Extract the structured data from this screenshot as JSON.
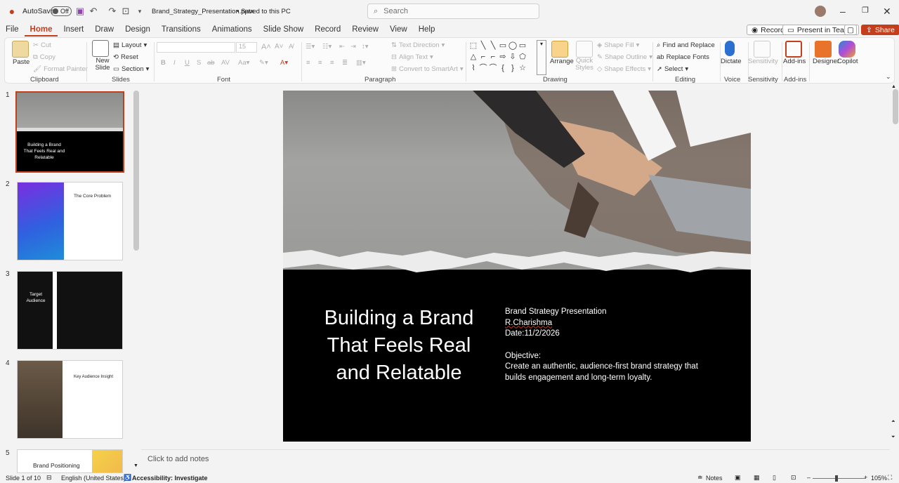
{
  "titlebar": {
    "autosave_label": "AutoSave",
    "autosave_state": "Off",
    "filename": "Brand_Strategy_Presentation.pptx",
    "save_status": "• Saved to this PC",
    "search_placeholder": "Search"
  },
  "menu": {
    "tabs": [
      "File",
      "Home",
      "Insert",
      "Draw",
      "Design",
      "Transitions",
      "Animations",
      "Slide Show",
      "Record",
      "Review",
      "View",
      "Help"
    ],
    "active": "Home",
    "record_btn": "Record",
    "present_btn": "Present in Teams",
    "share_btn": "Share"
  },
  "ribbon": {
    "clipboard": {
      "paste": "Paste",
      "cut": "Cut",
      "copy": "Copy",
      "format_painter": "Format Painter",
      "label": "Clipboard"
    },
    "slides": {
      "new_slide": "New Slide",
      "layout": "Layout",
      "reset": "Reset",
      "section": "Section",
      "label": "Slides"
    },
    "font": {
      "label": "Font",
      "size": "15"
    },
    "paragraph": {
      "text_direction": "Text Direction",
      "align_text": "Align Text",
      "smartart": "Convert to SmartArt",
      "label": "Paragraph"
    },
    "drawing": {
      "arrange": "Arrange",
      "quick_styles": "Quick Styles",
      "shape_fill": "Shape Fill",
      "shape_outline": "Shape Outline",
      "shape_effects": "Shape Effects",
      "label": "Drawing"
    },
    "editing": {
      "find_replace": "Find and Replace",
      "replace_fonts": "Replace Fonts",
      "select": "Select",
      "label": "Editing"
    },
    "voice": {
      "dictate": "Dictate",
      "label": "Voice"
    },
    "sensitivity": {
      "btn": "Sensitivity",
      "label": "Sensitivity"
    },
    "addins": {
      "btn": "Add-ins",
      "label": "Add-ins"
    },
    "designer": "Designer",
    "copilot": "Copilot"
  },
  "thumbnails": [
    {
      "num": "1",
      "title": "Building a Brand That Feels Real and Relatable"
    },
    {
      "num": "2",
      "title": "The Core Problem"
    },
    {
      "num": "3",
      "title": "Target Audience"
    },
    {
      "num": "4",
      "title": "Key Audience Insight"
    },
    {
      "num": "5",
      "title": "Brand Positioning"
    }
  ],
  "slide": {
    "title": "Building a Brand That Feels Real and Relatable",
    "subtitle": "Brand Strategy Presentation",
    "author": "R.Charishma",
    "date": "Date:11/2/2026",
    "objective_label": "Objective:",
    "objective_text": "Create an authentic, audience-first brand strategy that builds engagement and long-term loyalty."
  },
  "notes_placeholder": "Click to add notes",
  "status": {
    "slide_count": "Slide 1 of 10",
    "language": "English (United States)",
    "accessibility": "Accessibility: Investigate",
    "notes": "Notes",
    "zoom": "105%"
  }
}
